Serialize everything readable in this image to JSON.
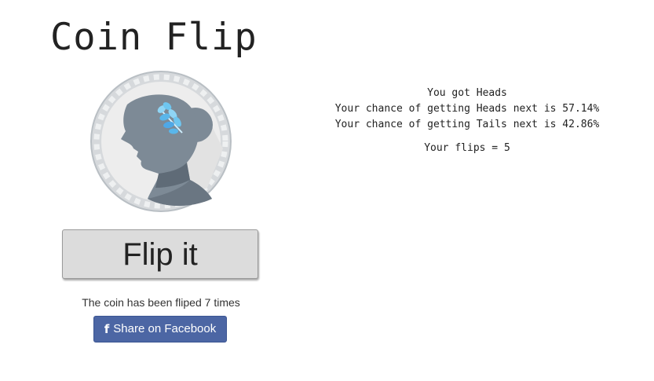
{
  "title": "Coin Flip",
  "coin": {
    "icon": "coin-head-icon",
    "colors": {
      "rim": "#d7dadd",
      "face": "#eeeeee",
      "bust": "#7d8a96",
      "bust_shadow": "#5f6b77",
      "leaf": "#6ec6f0"
    }
  },
  "flip_button_label": "Flip it",
  "global_flip_text": "The coin has been fliped 7 times",
  "share": {
    "icon": "facebook-icon",
    "icon_glyph": "f",
    "label": "Share on Facebook",
    "color": "#4c66a4"
  },
  "result": {
    "last_result": "You got Heads",
    "heads_chance": "Your chance of getting Heads next is 57.14%",
    "tails_chance": "Your chance of getting Tails next is 42.86%",
    "your_flips": "Your flips = 5"
  }
}
